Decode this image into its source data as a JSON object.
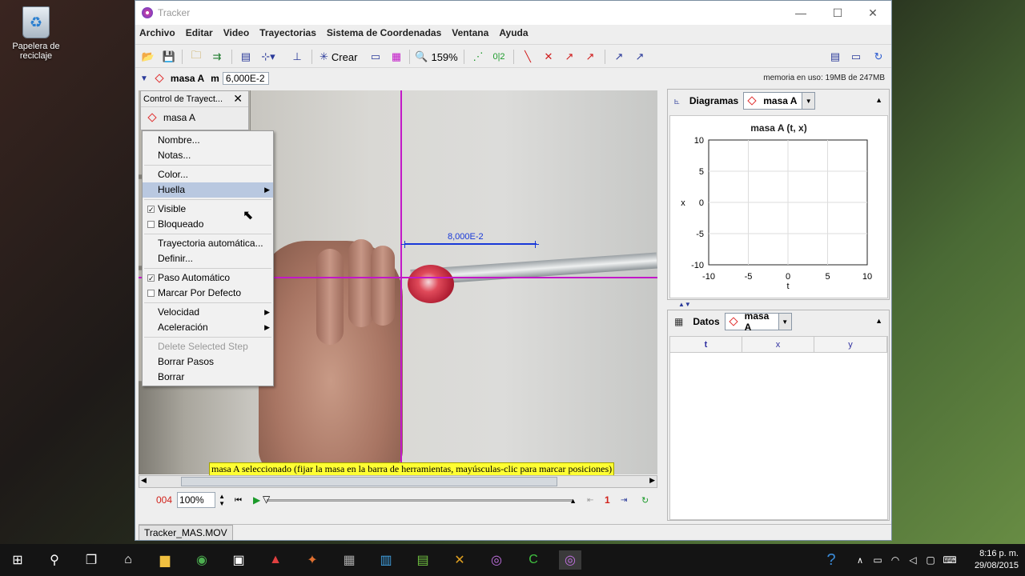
{
  "desktop": {
    "recycle_bin": "Papelera de reciclaje"
  },
  "window": {
    "title": "Tracker"
  },
  "menubar": [
    "Archivo",
    "Editar",
    "Video",
    "Trayectorias",
    "Sistema de Coordenadas",
    "Ventana",
    "Ayuda"
  ],
  "toolbar": {
    "create_label": "Crear",
    "zoom": "159%",
    "step_label": "0|2"
  },
  "track_bar": {
    "track_name": "masa A",
    "mass_label": "m",
    "mass_value": "6,000E-2",
    "memory": "memoria en uso: 19MB de 247MB"
  },
  "video": {
    "tape_value": "8,000E-2",
    "status": "masa A seleccionado (fijar la masa en la barra de herramientas, mayúsculas-clic para marcar posiciones)"
  },
  "player": {
    "frame": "004",
    "rate": "100%",
    "step": "1"
  },
  "doc_tab": "Tracker_MAS.MOV",
  "control": {
    "title": "Control de Trayect...",
    "track": "masa A"
  },
  "context_menu": {
    "nombre": "Nombre...",
    "notas": "Notas...",
    "color": "Color...",
    "huella": "Huella",
    "visible": "Visible",
    "bloqueado": "Bloqueado",
    "traj_auto": "Trayectoria automática...",
    "definir": "Definir...",
    "paso_auto": "Paso Automático",
    "marcar": "Marcar Por Defecto",
    "velocidad": "Velocidad",
    "aceleracion": "Aceleración",
    "delete_step": "Delete Selected Step",
    "borrar_pasos": "Borrar Pasos",
    "borrar": "Borrar"
  },
  "plot_panel": {
    "label": "Diagramas",
    "selected": "masa A",
    "plot_title": "masa A (t, x)",
    "x_label": "t",
    "y_label": "x",
    "x_ticks": [
      "-10",
      "-5",
      "0",
      "5",
      "10"
    ],
    "y_ticks": [
      "10",
      "5",
      "0",
      "-5",
      "-10"
    ]
  },
  "data_panel": {
    "label": "Datos",
    "selected": "masa A",
    "columns": [
      "t",
      "x",
      "y"
    ]
  },
  "taskbar": {
    "time": "8:16 p. m.",
    "date": "29/08/2015"
  },
  "colors": {
    "crosshair": "#c218c8",
    "tape": "#1838d8",
    "status_bg": "#ffff33",
    "track_diamond": "#e03030"
  }
}
